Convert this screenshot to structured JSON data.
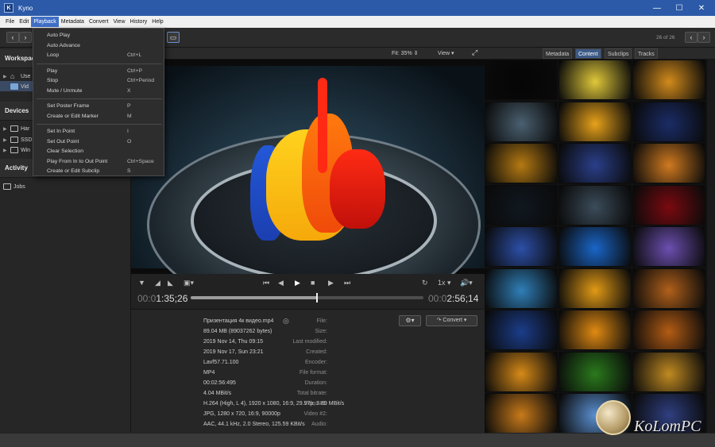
{
  "window": {
    "title": "Kyno",
    "app_icon": "K"
  },
  "menu": [
    "File",
    "Edit",
    "Playback",
    "Metadata",
    "Convert",
    "View",
    "History",
    "Help"
  ],
  "toolbar": {
    "counter": "26 of 26"
  },
  "sidebar": {
    "workspace_label": "Workspace",
    "workspace_items": [
      "Use",
      "Vid"
    ],
    "devices_label": "Devices",
    "device_items": [
      "Har",
      "SSD",
      "Win"
    ],
    "activity_label": "Activity",
    "jobs_label": "Jobs"
  },
  "preview": {
    "fit": "Fit: 35%",
    "view": "View"
  },
  "transport": {
    "position": {
      "prefix": "00:0",
      "main": "1:35;26"
    },
    "duration": {
      "prefix": "00:0",
      "main": "2:56;14"
    },
    "progress": 0.541,
    "speed": "1x"
  },
  "metadata": {
    "convert_label": "Convert",
    "rows": [
      {
        "label": "File:",
        "value": "Призентация 4к видео.mp4"
      },
      {
        "label": "Size:",
        "value": "89.04 MB (89037262 bytes)"
      },
      {
        "label": "Last modified:",
        "value": "2019 Nov 14, Thu 09:15"
      },
      {
        "label": "Created:",
        "value": "2019 Nov 17, Sun 23:21"
      },
      {
        "label": "Encoder:",
        "value": "Lavf57.71.100"
      },
      {
        "label": "File format:",
        "value": "MP4"
      },
      {
        "label": "Duration:",
        "value": "00:02:56:495"
      },
      {
        "label": "Total bitrate:",
        "value": "4.04 MBit/s"
      },
      {
        "label": "Video #1:",
        "value": "H.264 (High, L 4), 1920 x 1080, 16:9, 29.97p, 3.89 MBit/s"
      },
      {
        "label": "Video #2:",
        "value": "JPG, 1280 x 720, 16:9, 90000p"
      },
      {
        "label": "Audio:",
        "value": "AAC, 44.1 kHz, 2.0 Stereo, 125.59 KBit/s"
      }
    ]
  },
  "right_tabs": [
    {
      "label": "Metadata",
      "active": false
    },
    {
      "label": "Content",
      "active": true
    },
    {
      "label": "Subclips",
      "active": false
    },
    {
      "label": "Tracks",
      "active": false
    }
  ],
  "playback_menu": [
    {
      "label": "Auto Play",
      "shortcut": ""
    },
    {
      "label": "Auto Advance",
      "shortcut": ""
    },
    {
      "label": "Loop",
      "shortcut": "Ctrl+L"
    },
    {
      "separator": true
    },
    {
      "label": "Play",
      "shortcut": "Ctrl+P"
    },
    {
      "label": "Stop",
      "shortcut": "Ctrl+Period"
    },
    {
      "label": "Mute / Unmute",
      "shortcut": "X"
    },
    {
      "separator": true
    },
    {
      "label": "Set Poster Frame",
      "shortcut": "P"
    },
    {
      "label": "Create or Edit Marker",
      "shortcut": "M"
    },
    {
      "separator": true
    },
    {
      "label": "Set In Point",
      "shortcut": "I"
    },
    {
      "label": "Set Out Point",
      "shortcut": "O"
    },
    {
      "label": "Clear Selection",
      "shortcut": ""
    },
    {
      "label": "Play From In to Out Point",
      "shortcut": "Ctrl+Space"
    },
    {
      "label": "Create or Edit Subclip",
      "shortcut": "S"
    }
  ],
  "thumb_colors": [
    [
      "#050505",
      "#e0c83a",
      "#d28b1c"
    ],
    [
      "#4a6070",
      "#e7a21a",
      "#1a2c66"
    ],
    [
      "#b57a12",
      "#2a3f8a",
      "#d07a20"
    ],
    [
      "#101820",
      "#3b4c5a",
      "#7a0a10"
    ],
    [
      "#2c4fa8",
      "#1a66c8",
      "#6c4fb0"
    ],
    [
      "#2f7fb8",
      "#e29a16",
      "#b0601a"
    ],
    [
      "#1b3d8a",
      "#e08a12",
      "#b35c14"
    ],
    [
      "#d78a18",
      "#2a7a1c",
      "#c08a22"
    ],
    [
      "#c87a1a",
      "#5a8fd0",
      "#2f3f80"
    ]
  ],
  "watermark": "KoLomPC"
}
